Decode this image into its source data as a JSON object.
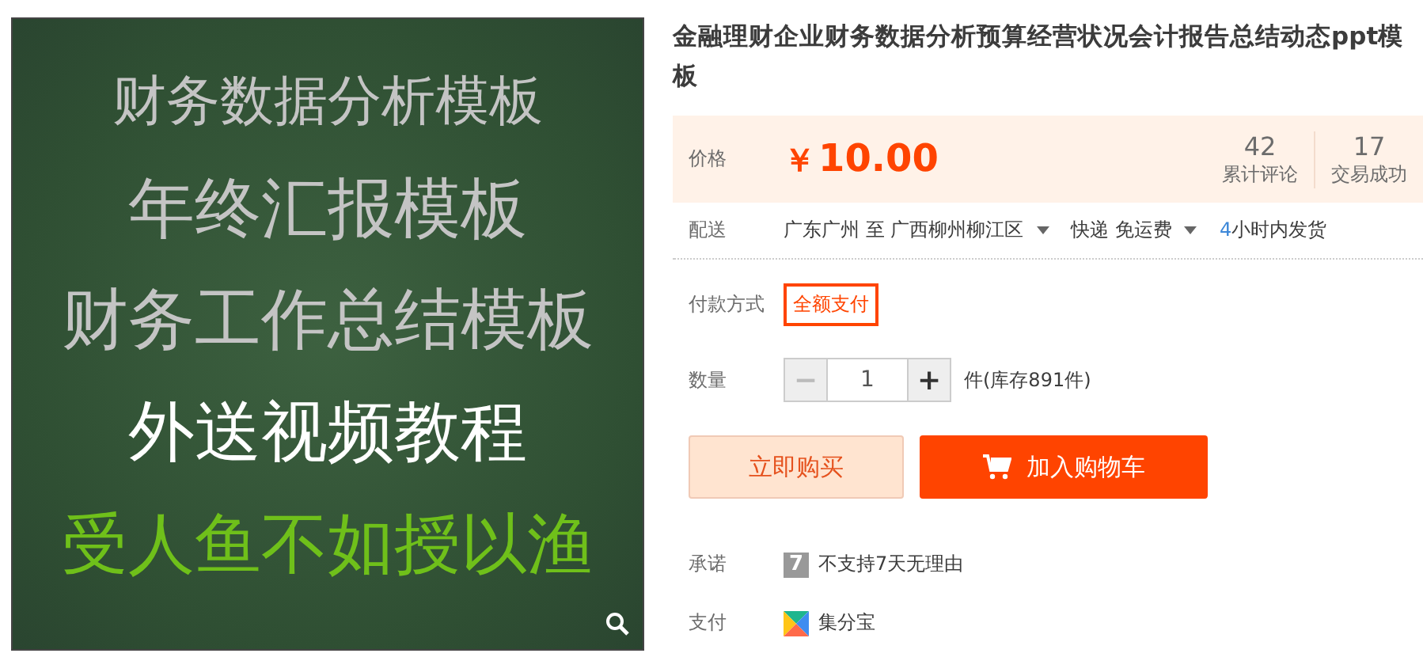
{
  "product_image": {
    "lines": [
      {
        "text": "财务数据分析模板",
        "color": "#c4c4c4",
        "kind": "small"
      },
      {
        "text": "年终汇报模板",
        "color": "#c4c4c4",
        "kind": "large"
      },
      {
        "text": "财务工作总结模板",
        "color": "#c4c4c4",
        "kind": "large"
      },
      {
        "text": "外送视频教程",
        "color": "#ffffff",
        "kind": "large"
      },
      {
        "text": "受人鱼不如授以渔",
        "color": "#6fc01a",
        "kind": "large"
      }
    ]
  },
  "title": "金融理财企业财务数据分析预算经营状况会计报告总结动态ppt模板",
  "price": {
    "label": "价格",
    "currency": "￥",
    "amount": "10.00",
    "stats": [
      {
        "value": "42",
        "label": "累计评论"
      },
      {
        "value": "17",
        "label": "交易成功"
      }
    ]
  },
  "delivery": {
    "label": "配送",
    "from": "广东广州 至",
    "to": "广西柳州柳江区",
    "method": "快递 免运费",
    "ship_hours": "4",
    "ship_text": "小时内发货"
  },
  "payment_method": {
    "label": "付款方式",
    "options": [
      {
        "label": "全额支付",
        "selected": true
      }
    ]
  },
  "quantity": {
    "label": "数量",
    "minus": "−",
    "plus": "+",
    "minus_disabled": true,
    "value": "1",
    "stock": "件(库存891件)"
  },
  "buttons": [
    {
      "kind": "buy",
      "label": "立即购买"
    },
    {
      "kind": "cart",
      "label": "加入购物车"
    }
  ],
  "services": [
    {
      "kind": "promise",
      "label": "承诺",
      "badge": "7",
      "text": "不支持7天无理由"
    },
    {
      "kind": "pay",
      "label": "支付",
      "text": "集分宝"
    }
  ]
}
